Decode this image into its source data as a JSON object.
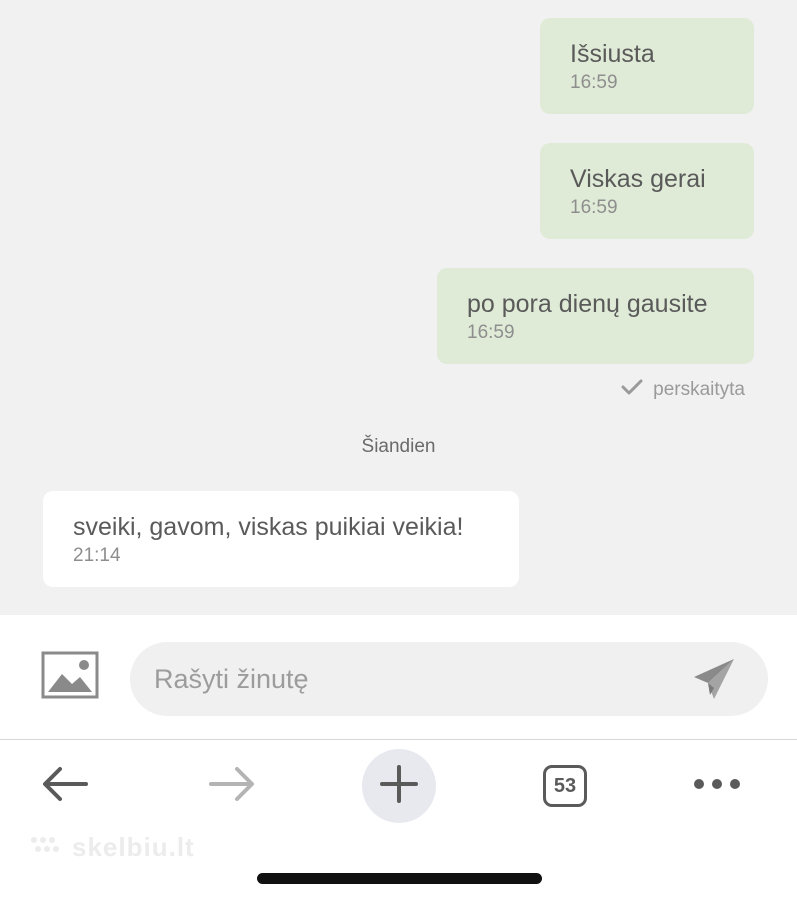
{
  "messages": [
    {
      "direction": "out",
      "text": "Išsiusta",
      "time": "16:59"
    },
    {
      "direction": "out",
      "text": "Viskas gerai",
      "time": "16:59"
    },
    {
      "direction": "out",
      "text": "po pora dienų gausite",
      "time": "16:59"
    },
    {
      "direction": "in",
      "text": "sveiki, gavom, viskas puikiai veikia!",
      "time": "21:14"
    }
  ],
  "read_receipt": {
    "label": "perskaityta",
    "icon": "checkmark-icon"
  },
  "day_separator": "Šiandien",
  "composer": {
    "placeholder": "Rašyti žinutę",
    "attach_icon": "image-icon",
    "send_icon": "paper-plane-icon"
  },
  "toolbar": {
    "back_icon": "arrow-left-icon",
    "forward_icon": "arrow-right-icon",
    "new_tab_icon": "plus-icon",
    "tab_count": "53",
    "menu_icon": "more-icon"
  },
  "watermark": "skelbiu.lt",
  "colors": {
    "outgoing_bubble": "#dfebd7",
    "incoming_bubble": "#ffffff",
    "chat_background": "#f1f1f1"
  }
}
